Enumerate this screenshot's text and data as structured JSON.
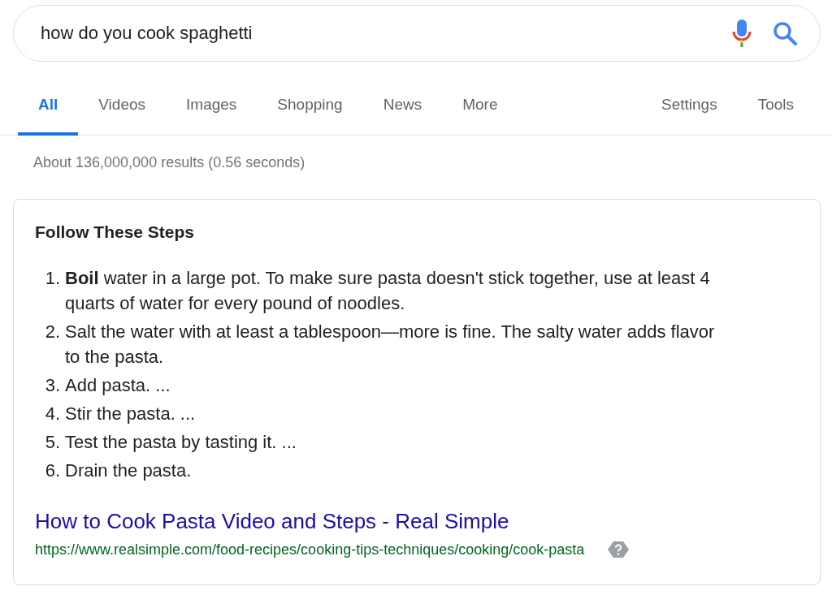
{
  "search": {
    "value": "how do you cook spaghetti"
  },
  "tabs": [
    {
      "label": "All",
      "selected": true
    },
    {
      "label": "Videos",
      "selected": false
    },
    {
      "label": "Images",
      "selected": false
    },
    {
      "label": "Shopping",
      "selected": false
    },
    {
      "label": "News",
      "selected": false
    },
    {
      "label": "More",
      "selected": false
    }
  ],
  "tools_tabs": [
    {
      "label": "Settings",
      "selected": false
    },
    {
      "label": "Tools",
      "selected": false
    }
  ],
  "result_stats": "About 136,000,000 results (0.56 seconds)",
  "snippet": {
    "title": "Follow These Steps",
    "steps": [
      {
        "number": "1.",
        "text": "**Boil** water in a large pot. To make sure pasta doesn't stick together, use at least 4 quarts of water for every pound of noodles."
      },
      {
        "number": "2.",
        "text": "Salt the water with at least a tablespoon—more is fine. The salty water adds flavor to the pasta."
      },
      {
        "number": "3.",
        "text": "Add pasta. ..."
      },
      {
        "number": "4.",
        "text": "Stir the pasta. ..."
      },
      {
        "number": "5.",
        "text": "Test the pasta by tasting it. ..."
      },
      {
        "number": "6.",
        "text": "Drain the pasta."
      }
    ],
    "link": "How to Cook Pasta Video and Steps - Real Simple",
    "url": "https://www.realsimple.com/food-recipes/cooking-tips-techniques/cooking/cook-pasta"
  }
}
